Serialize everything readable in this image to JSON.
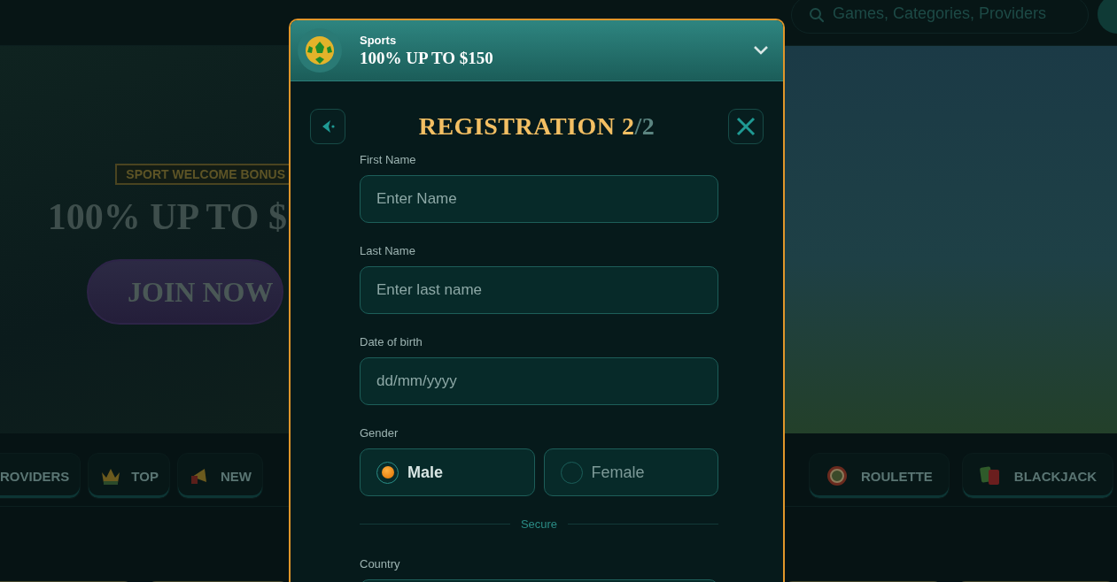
{
  "header": {
    "search": {
      "placeholder": "Games, Categories, Providers"
    }
  },
  "hero": {
    "tag": "SPORT WELCOME BONUS",
    "headline": "100% UP TO $",
    "button": "JOIN NOW"
  },
  "categories_left": [
    {
      "label": "ROVIDERS"
    },
    {
      "label": "TOP"
    },
    {
      "label": "NEW"
    }
  ],
  "categories_right": [
    {
      "label": "ROULETTE"
    },
    {
      "label": "BLACKJACK"
    }
  ],
  "modal": {
    "bonus": {
      "category": "Sports",
      "offer": "100% UP TO $150"
    },
    "title_main": "REGISTRATION 2",
    "title_rest": "/2",
    "fields": [
      {
        "kind": "text",
        "label": "First Name",
        "placeholder": "Enter Name"
      },
      {
        "kind": "text",
        "label": "Last Name",
        "placeholder": "Enter last name"
      },
      {
        "kind": "text",
        "label": "Date of birth",
        "placeholder": "dd/mm/yyyy"
      },
      {
        "kind": "radio",
        "label": "Gender",
        "options": [
          {
            "label": "Male",
            "selected": true
          },
          {
            "label": "Female",
            "selected": false
          }
        ]
      },
      {
        "kind": "divider",
        "label": "Secure"
      },
      {
        "kind": "text",
        "label": "Country"
      }
    ]
  }
}
